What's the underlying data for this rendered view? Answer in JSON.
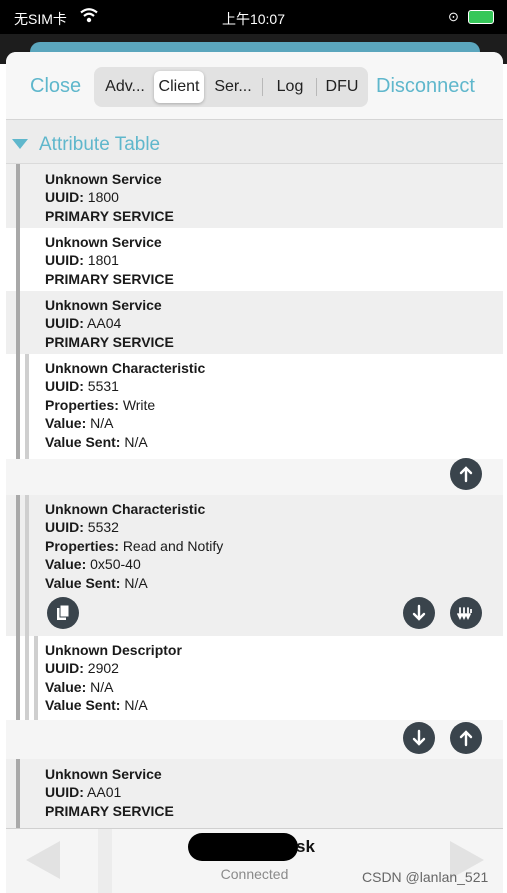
{
  "status_bar": {
    "carrier": "无SIM卡",
    "time": "上午10:07"
  },
  "navbar": {
    "close_label": "Close",
    "disconnect_label": "Disconnect",
    "tabs": [
      {
        "label": "Adv...",
        "active": false
      },
      {
        "label": "Client",
        "active": true
      },
      {
        "label": "Ser...",
        "active": false
      },
      {
        "label": "Log",
        "active": false
      },
      {
        "label": "DFU",
        "active": false
      }
    ]
  },
  "section": {
    "title": "Attribute Table"
  },
  "labels": {
    "uuid": "UUID:",
    "properties": "Properties:",
    "value": "Value:",
    "value_sent": "Value Sent:"
  },
  "rows": [
    {
      "kind": "service",
      "title": "Unknown Service",
      "uuid": "1800",
      "type": "PRIMARY SERVICE"
    },
    {
      "kind": "service",
      "title": "Unknown Service",
      "uuid": "1801",
      "type": "PRIMARY SERVICE"
    },
    {
      "kind": "service",
      "title": "Unknown Service",
      "uuid": "AA04",
      "type": "PRIMARY SERVICE"
    },
    {
      "kind": "characteristic",
      "title": "Unknown Characteristic",
      "uuid": "5531",
      "properties": "Write",
      "value": "N/A",
      "value_sent": "N/A",
      "actions": [
        "write-icon"
      ]
    },
    {
      "kind": "characteristic",
      "title": "Unknown Characteristic",
      "uuid": "5532",
      "properties": "Read and Notify",
      "value": "0x50-40",
      "value_sent": "N/A",
      "actions": [
        "copy-icon",
        "read-icon",
        "notify-icon"
      ]
    },
    {
      "kind": "descriptor",
      "title": "Unknown Descriptor",
      "uuid": "2902",
      "value": "N/A",
      "value_sent": "N/A",
      "actions": [
        "read-icon",
        "write-icon"
      ]
    },
    {
      "kind": "service",
      "title": "Unknown Service",
      "uuid": "AA01",
      "type": "PRIMARY SERVICE"
    }
  ],
  "footer": {
    "device_name_visible": "sk",
    "status": "Connected"
  },
  "watermark": "CSDN @lanlan_521",
  "colors": {
    "accent": "#5fb7cc",
    "icon_bg": "#3a444c",
    "row_shade": "#efefef"
  }
}
